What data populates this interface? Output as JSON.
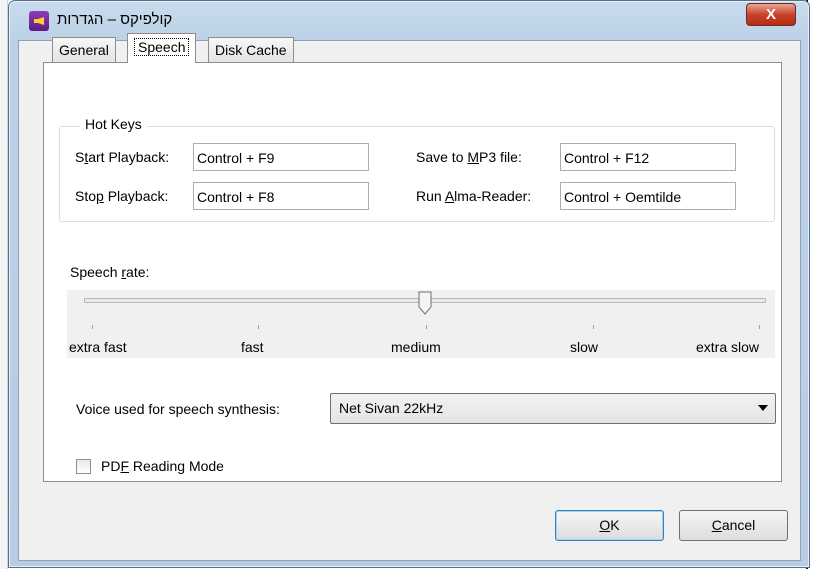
{
  "window": {
    "title": "קולפיקס – הגדרות",
    "close_symbol": "X"
  },
  "tabs": [
    {
      "label": "General",
      "active": false
    },
    {
      "label": "Speech",
      "active": true
    },
    {
      "label": "Disk Cache",
      "active": false
    }
  ],
  "hotkeys": {
    "group_title": "Hot Keys",
    "start_playback": {
      "label_pre": "S",
      "label_ul": "t",
      "label_post": "art Playback:",
      "value": "Control + F9"
    },
    "stop_playback": {
      "label_pre": "Sto",
      "label_ul": "p",
      "label_post": " Playback:",
      "value": "Control + F8"
    },
    "save_mp3": {
      "label_pre": "Save to ",
      "label_ul": "M",
      "label_post": "P3 file:",
      "value": "Control + F12"
    },
    "run_alma": {
      "label_pre": "Run ",
      "label_ul": "A",
      "label_post": "lma-Reader:",
      "value": "Control + Oemtilde"
    }
  },
  "speech_rate": {
    "label_pre": "Speech ",
    "label_ul": "r",
    "label_post": "ate:",
    "ticks": [
      "extra fast",
      "fast",
      "medium",
      "slow",
      "extra slow"
    ],
    "selected": "medium",
    "selected_fraction": 0.5
  },
  "voice": {
    "label": "Voice used for speech synthesis:",
    "selected": "Net Sivan 22kHz"
  },
  "pdf_mode": {
    "label_pre": "PD",
    "label_ul": "F",
    "label_post": " Reading Mode",
    "checked": false
  },
  "buttons": {
    "ok": {
      "ul": "O",
      "post": "K"
    },
    "cancel": {
      "ul": "C",
      "post": "ancel"
    }
  },
  "colors": {
    "titlebar": "#c9dcee",
    "close_button": "#c9432b",
    "default_button_border": "#3c7fb1"
  }
}
